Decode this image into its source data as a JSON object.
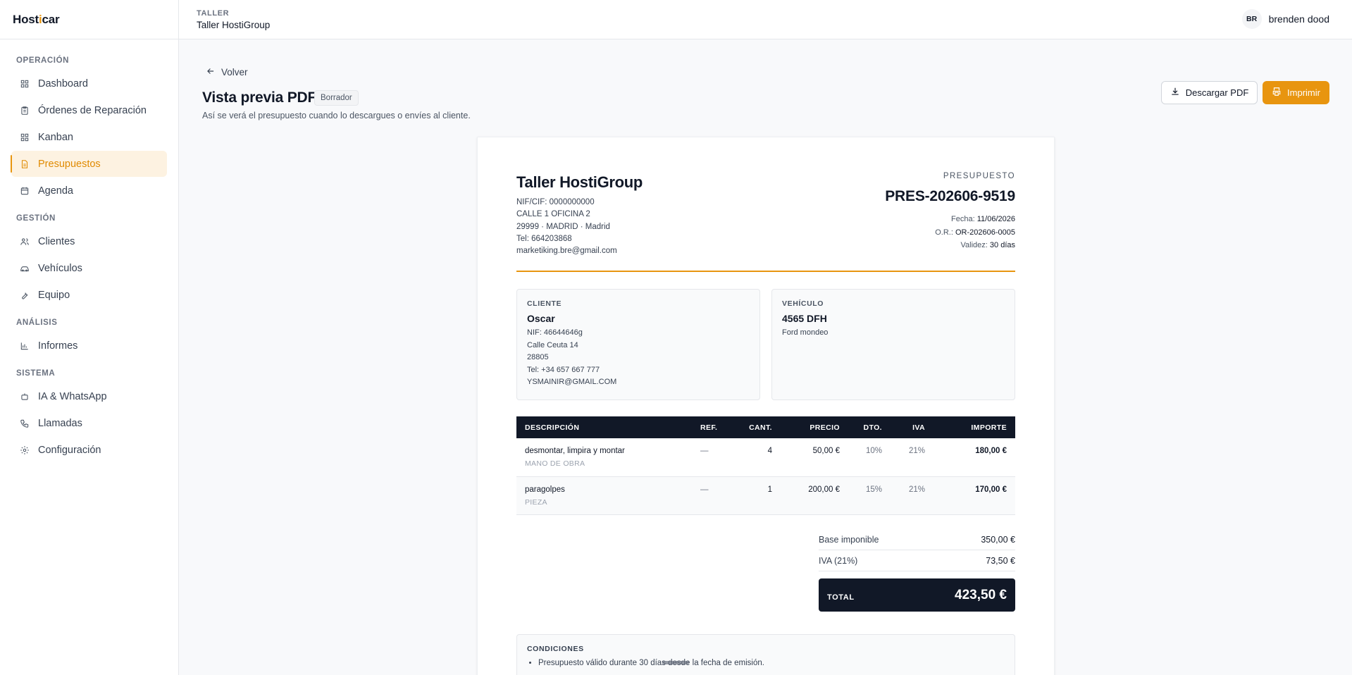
{
  "brand": {
    "prefix": "Host",
    "accent": "i",
    "suffix": "car"
  },
  "topbar": {
    "kicker": "TALLER",
    "workspace": "Taller HostiGroup"
  },
  "user": {
    "initials": "BR",
    "name": "brenden dood"
  },
  "sidebar": {
    "sections": [
      {
        "title": "OPERACIÓN",
        "items": [
          {
            "label": "Dashboard",
            "icon": "grid-icon"
          },
          {
            "label": "Órdenes de Reparación",
            "icon": "clipboard-icon"
          },
          {
            "label": "Kanban",
            "icon": "grid-icon"
          },
          {
            "label": "Presupuestos",
            "icon": "document-icon",
            "active": true
          },
          {
            "label": "Agenda",
            "icon": "calendar-icon"
          }
        ]
      },
      {
        "title": "GESTIÓN",
        "items": [
          {
            "label": "Clientes",
            "icon": "users-icon"
          },
          {
            "label": "Vehículos",
            "icon": "car-icon"
          },
          {
            "label": "Equipo",
            "icon": "wrench-icon"
          }
        ]
      },
      {
        "title": "ANÁLISIS",
        "items": [
          {
            "label": "Informes",
            "icon": "bar-chart-icon"
          }
        ]
      },
      {
        "title": "SISTEMA",
        "items": [
          {
            "label": "IA & WhatsApp",
            "icon": "bot-icon"
          },
          {
            "label": "Llamadas",
            "icon": "phone-icon"
          },
          {
            "label": "Configuración",
            "icon": "gear-icon"
          }
        ]
      }
    ]
  },
  "page": {
    "back": "Volver",
    "title": "Vista previa PDF",
    "badge": "Borrador",
    "subtitle": "Así se verá el presupuesto cuando lo descargues o envíes al cliente.",
    "download": "Descargar PDF",
    "print": "Imprimir"
  },
  "doc": {
    "shop": {
      "name": "Taller HostiGroup",
      "lines": [
        "NIF/CIF: 0000000000",
        "CALLE 1 OFICINA 2",
        "29999 · MADRID · Madrid",
        "Tel: 664203868",
        "marketiking.bre@gmail.com"
      ]
    },
    "quote": {
      "kicker": "PRESUPUESTO",
      "number": "PRES-202606-9519",
      "fecha_label": "Fecha:",
      "fecha": "11/06/2026",
      "or_label": "O.R.:",
      "or": "OR-202606-0005",
      "validez_label": "Validez:",
      "validez": "30 días"
    },
    "client": {
      "kicker": "CLIENTE",
      "name": "Oscar",
      "lines": [
        "NIF: 46644646g",
        "Calle Ceuta 14",
        "28805",
        "Tel: +34 657 667 777",
        "YSMAINIR@GMAIL.COM"
      ]
    },
    "vehicle": {
      "kicker": "VEHÍCULO",
      "plate": "4565 DFH",
      "model": "Ford mondeo"
    },
    "table": {
      "headers": [
        "DESCRIPCIÓN",
        "REF.",
        "CANT.",
        "PRECIO",
        "DTO.",
        "IVA",
        "IMPORTE"
      ],
      "rows": [
        {
          "desc": "desmontar, limpira y montar",
          "cat": "MANO DE OBRA",
          "ref": "—",
          "qty": "4",
          "price": "50,00 €",
          "dto": "10%",
          "iva": "21%",
          "amount": "180,00 €"
        },
        {
          "desc": "paragolpes",
          "cat": "PIEZA",
          "ref": "—",
          "qty": "1",
          "price": "200,00 €",
          "dto": "15%",
          "iva": "21%",
          "amount": "170,00 €"
        }
      ]
    },
    "totals": {
      "base_label": "Base imponible",
      "base": "350,00 €",
      "iva_label": "IVA (21%)",
      "iva": "73,50 €",
      "total_label": "TOTAL",
      "total": "423,50 €"
    },
    "conditions": {
      "kicker": "CONDICIONES",
      "items": [
        "Presupuesto válido durante 30 días desde la fecha de emisión."
      ]
    }
  },
  "colors": {
    "accent": "#e8950f",
    "dark": "#111827",
    "active_bg": "#fdf2e1"
  }
}
